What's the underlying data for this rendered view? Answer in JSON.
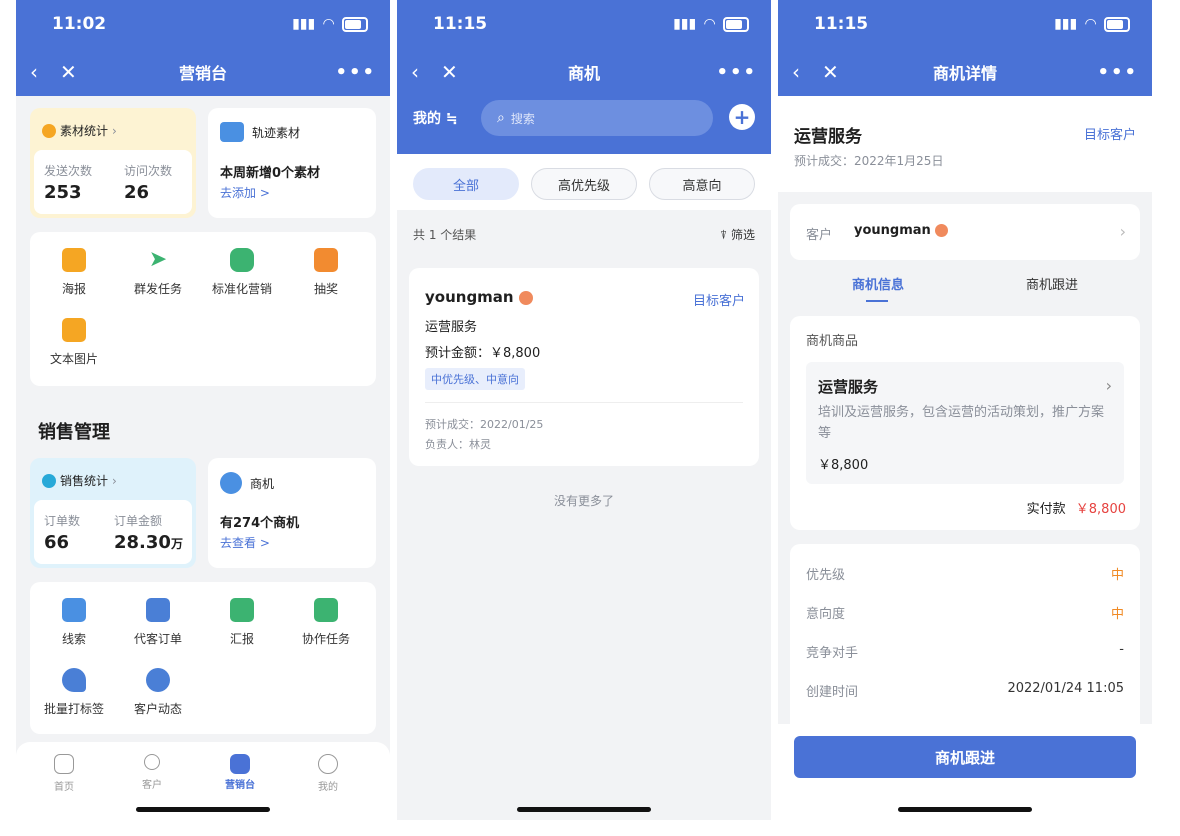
{
  "screen1": {
    "status_time": "11:02",
    "nav_title": "营销台",
    "material_stats": {
      "title": "素材统计",
      "col1_label": "发送次数",
      "col1_value": "253",
      "col2_label": "访问次数",
      "col2_value": "26"
    },
    "track_material": {
      "title": "轨迹素材",
      "headline": "本周新增0个素材",
      "link": "去添加 >"
    },
    "tools": [
      "海报",
      "群发任务",
      "标准化营销",
      "抽奖",
      "文本图片"
    ],
    "section_title": "销售管理",
    "sales_stats": {
      "title": "销售统计",
      "col1_label": "订单数",
      "col1_value": "66",
      "col2_label": "订单金额",
      "col2_value": "28.30",
      "col2_unit": "万"
    },
    "opportunity": {
      "title": "商机",
      "headline": "有274个商机",
      "link": "去查看 >"
    },
    "sales_tools": [
      "线索",
      "代客订单",
      "汇报",
      "协作任务",
      "批量打标签",
      "客户动态"
    ],
    "tabbar": [
      "首页",
      "客户",
      "营销台",
      "我的"
    ]
  },
  "screen2": {
    "status_time": "11:15",
    "nav_title": "商机",
    "filter_label": "我的 ≒",
    "search_placeholder": "搜索",
    "chips": [
      "全部",
      "高优先级",
      "高意向"
    ],
    "result_count": "共 1 个结果",
    "filter_btn": "筛选",
    "card": {
      "customer": "youngman",
      "tag": "目标客户",
      "product": "运营服务",
      "amount": "预计金额：￥8,800",
      "badge": "中优先级、中意向",
      "deal_date": "预计成交：2022/01/25",
      "owner": "负责人：林灵"
    },
    "no_more": "没有更多了"
  },
  "screen3": {
    "status_time": "11:15",
    "nav_title": "商机详情",
    "title": "运营服务",
    "tag": "目标客户",
    "deal_date": "预计成交：2022年1月25日",
    "customer_label": "客户",
    "customer_name": "youngman",
    "tabs": [
      "商机信息",
      "商机跟进"
    ],
    "goods_section": "商机商品",
    "product_name": "运营服务",
    "product_desc": "培训及运营服务，包含运营的活动策划，推广方案等",
    "product_price": "￥8,800",
    "paid_label": "实付款",
    "paid_value": "￥8,800",
    "details": [
      {
        "label": "优先级",
        "value": "中"
      },
      {
        "label": "意向度",
        "value": "中"
      },
      {
        "label": "竞争对手",
        "value": "-"
      },
      {
        "label": "创建时间",
        "value": "2022/01/24 11:05"
      }
    ],
    "follow_button": "商机跟进"
  },
  "colors": {
    "brand": "#4a72d6",
    "accent_orange": "#f08a24",
    "price_red": "#e64340"
  }
}
